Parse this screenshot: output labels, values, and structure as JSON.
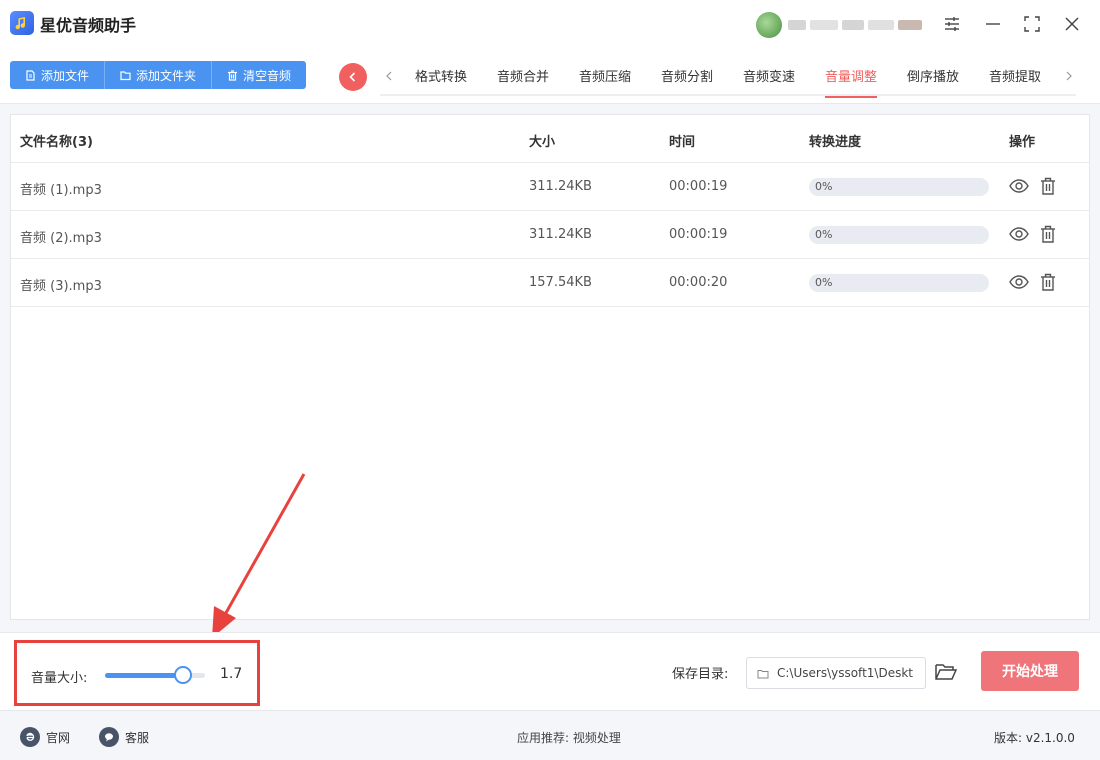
{
  "app": {
    "title": "星优音频助手",
    "icon": "music-note-icon"
  },
  "toolbar": {
    "buttons": [
      {
        "label": "添加文件",
        "icon": "file-icon"
      },
      {
        "label": "添加文件夹",
        "icon": "folder-icon"
      },
      {
        "label": "清空音频",
        "icon": "trash-icon"
      }
    ],
    "tabs": [
      "格式转换",
      "音频合并",
      "音频压缩",
      "音频分割",
      "音频变速",
      "音量调整",
      "倒序播放",
      "音频提取"
    ],
    "active_tab": "音量调整"
  },
  "table": {
    "headers": {
      "name": "文件名称(3)",
      "size": "大小",
      "time": "时间",
      "progress": "转换进度",
      "action": "操作"
    },
    "rows": [
      {
        "name": "音频 (1).mp3",
        "size": "311.24KB",
        "time": "00:00:19",
        "progress": "0%"
      },
      {
        "name": "音频 (2).mp3",
        "size": "311.24KB",
        "time": "00:00:19",
        "progress": "0%"
      },
      {
        "name": "音频 (3).mp3",
        "size": "157.54KB",
        "time": "00:00:20",
        "progress": "0%"
      }
    ]
  },
  "volume": {
    "label": "音量大小:",
    "value": "1.7",
    "slider_fraction": 0.78
  },
  "save": {
    "label": "保存目录:",
    "path": "C:\\Users\\yssoft1\\Deskt"
  },
  "start_button": "开始处理",
  "footer": {
    "website": "官网",
    "service": "客服",
    "recommend": "应用推荐:  视频处理",
    "version": "版本: v2.1.0.0"
  },
  "colors": {
    "primary": "#4a93f0",
    "accent": "#f0605e",
    "start_button": "#f0757a",
    "annotation": "#e8423f"
  }
}
